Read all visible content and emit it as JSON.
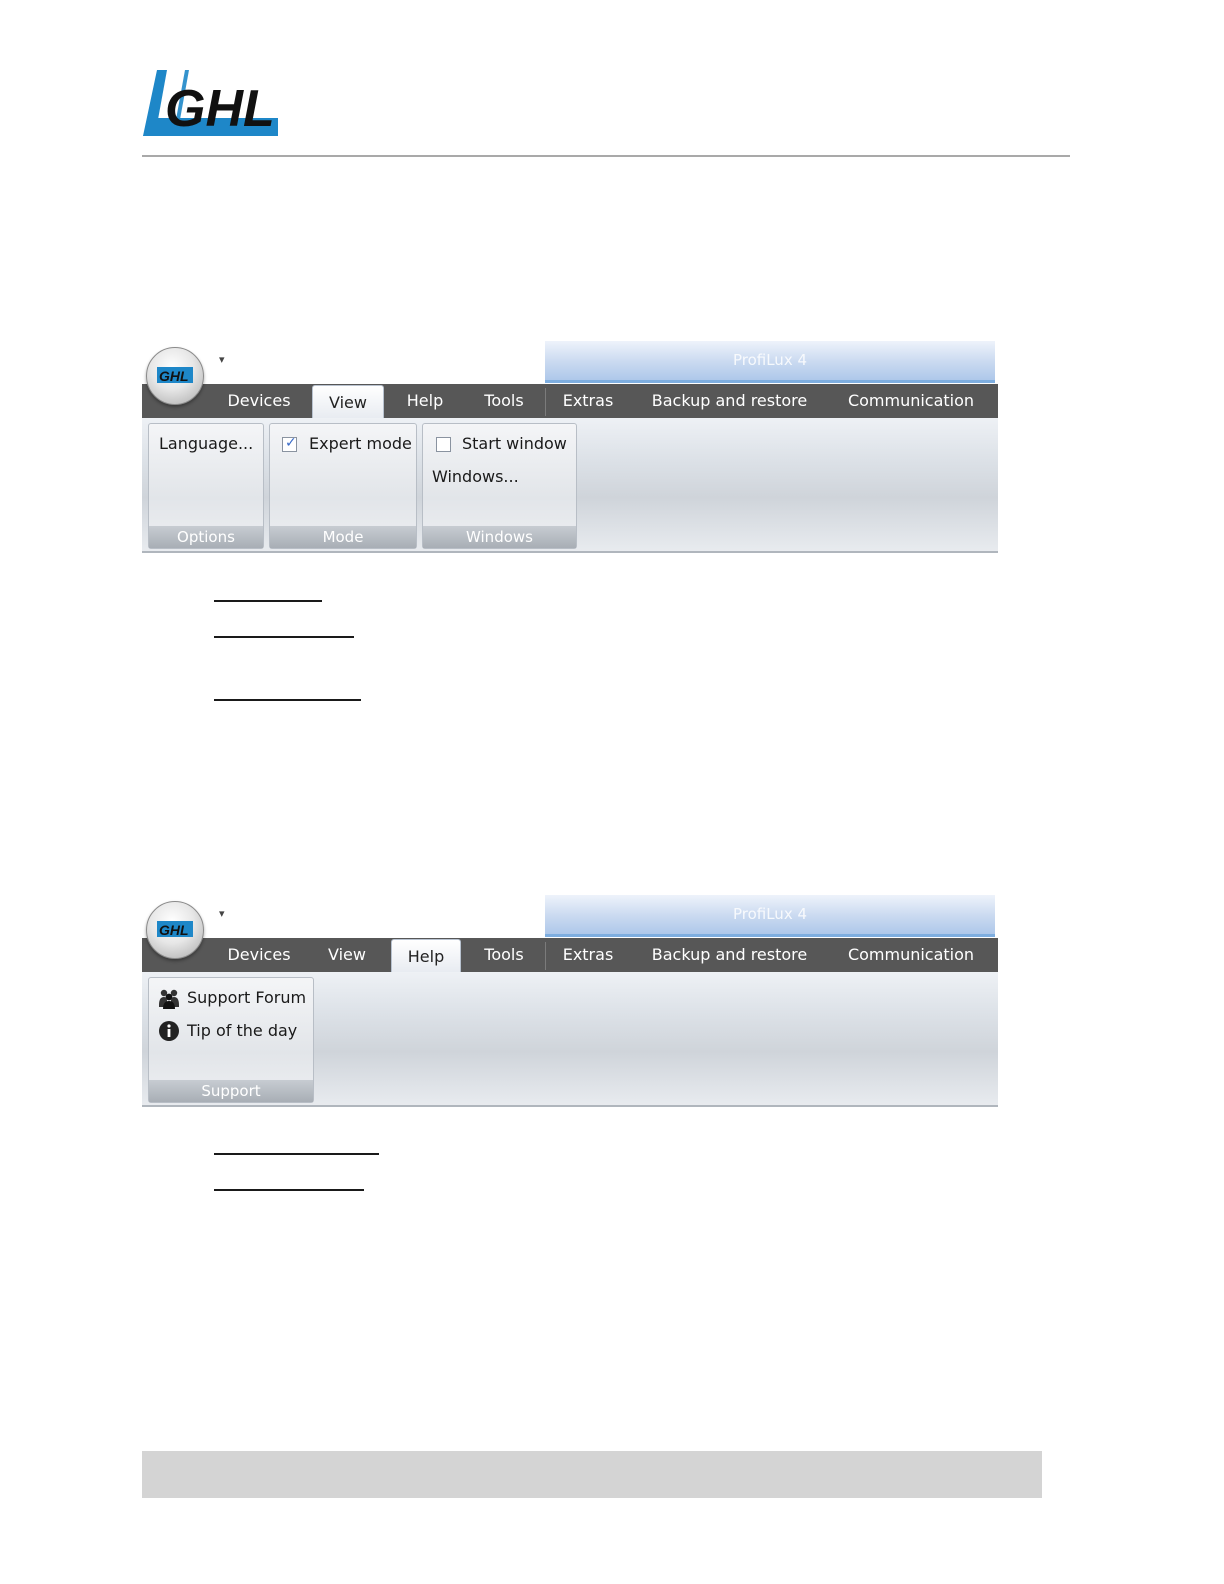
{
  "header": {
    "logo_text": "GHL",
    "brand_color": "#1e87c8"
  },
  "ribbon_view": {
    "window_title": "ProfiLux 4",
    "orb_logo_text": "GHL",
    "qat_icon": "dropdown-arrow-icon",
    "tabs": [
      "Devices",
      "View",
      "Help",
      "Tools",
      "Extras",
      "Backup and restore",
      "Communication"
    ],
    "active_tab": "View",
    "groups": {
      "options": {
        "label": "Options",
        "items": [
          "Language..."
        ]
      },
      "mode": {
        "label": "Mode",
        "checkbox_label": "Expert mode",
        "checked": true
      },
      "windows": {
        "label": "Windows",
        "checkbox_label": "Start window",
        "checked": false,
        "button_label": "Windows..."
      }
    }
  },
  "ribbon_help": {
    "window_title": "ProfiLux 4",
    "orb_logo_text": "GHL",
    "qat_icon": "dropdown-arrow-icon",
    "tabs": [
      "Devices",
      "View",
      "Help",
      "Tools",
      "Extras",
      "Backup and restore",
      "Communication"
    ],
    "active_tab": "Help",
    "groups": {
      "support": {
        "label": "Support",
        "items": [
          {
            "label": "Support Forum",
            "icon": "people-icon"
          },
          {
            "label": "Tip of the day",
            "icon": "info-icon"
          }
        ]
      }
    }
  }
}
